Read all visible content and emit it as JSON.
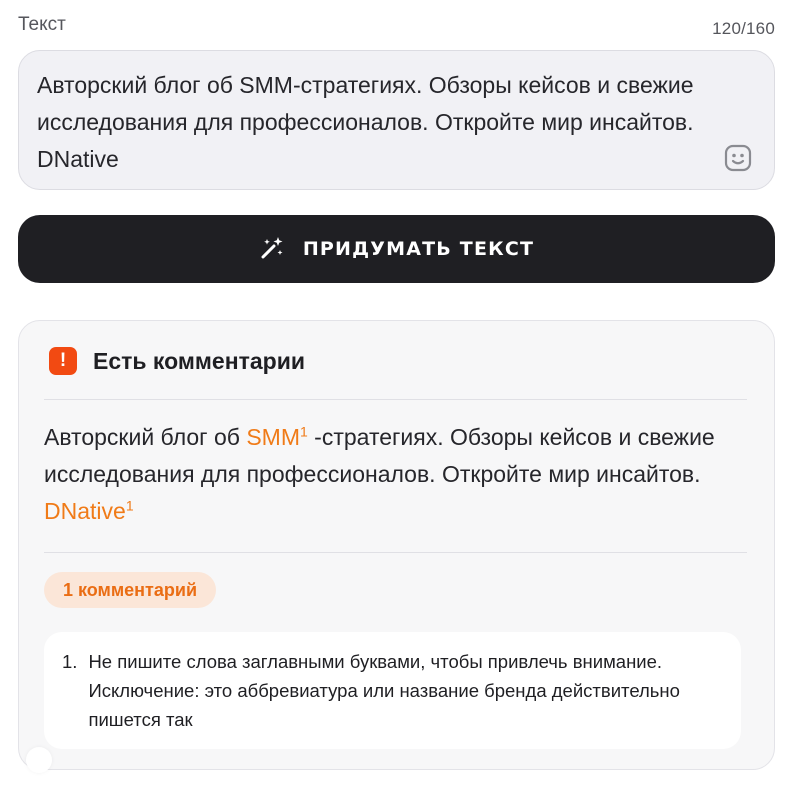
{
  "field": {
    "label": "Текст",
    "counter": "120/160",
    "value": "Авторский блог об SMM-стратегиях. Обзоры кейсов и свежие исследования для профессионалов. Откройте мир инсайтов. DNative",
    "emoji_icon": "smile-icon"
  },
  "generate_button": {
    "label": "ПРИДУМАТЬ ТЕКСТ",
    "icon": "magic-wand-icon"
  },
  "comments": {
    "title": "Есть комментарии",
    "alert_icon": "exclamation-icon",
    "checked_text": {
      "part1": "Авторский блог об ",
      "mark1": "SMM",
      "mark1_ref": "1",
      "part2": " -стратегиях. Обзоры кейсов и свежие исследования для профессионалов. Откройте мир инсайтов. ",
      "mark2": "DNative",
      "mark2_ref": "1"
    },
    "count_label": "1 комментарий",
    "items": [
      {
        "number": "1.",
        "text": "Не пишите слова заглавными буквами, чтобы привлечь внимание. Исключение: это аббревиатура или название бренда действительно пишется так"
      }
    ]
  },
  "colors": {
    "accent": "#f07b18",
    "alert": "#f24a12",
    "button_bg": "#1f1f23",
    "badge_bg": "#fbe6d8"
  }
}
